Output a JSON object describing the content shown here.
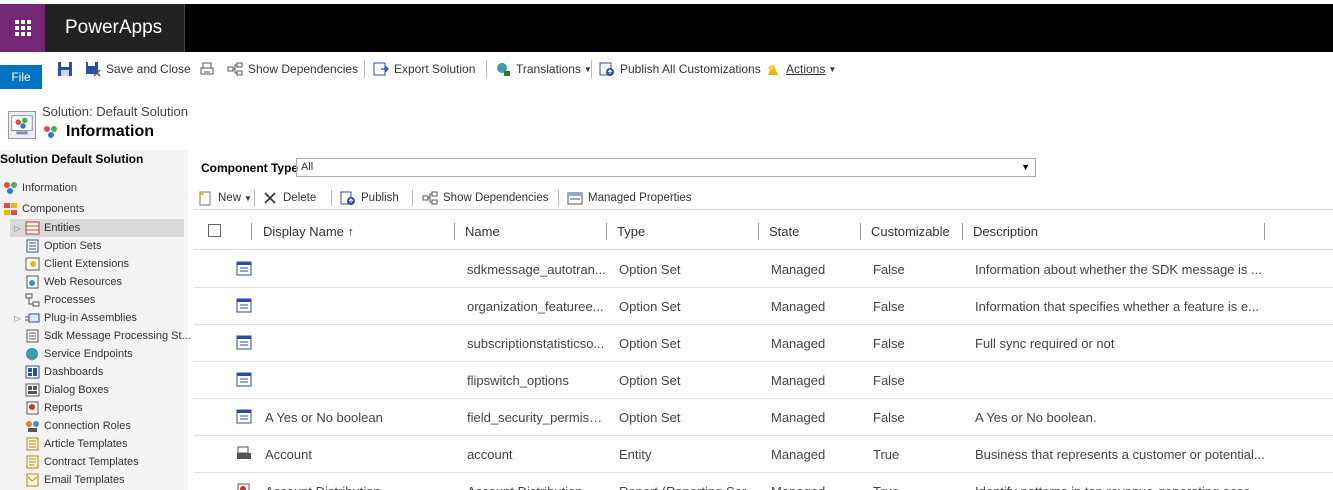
{
  "app": {
    "name": "PowerApps"
  },
  "ribbon": {
    "file": "File",
    "save_close": "Save and Close",
    "show_deps": "Show Dependencies",
    "export": "Export Solution",
    "translations": "Translations",
    "publish_all": "Publish All Customizations",
    "actions": "Actions"
  },
  "header": {
    "solution_line": "Solution: Default Solution",
    "title": "Information"
  },
  "leftnav": {
    "heading": "Solution Default Solution",
    "items": [
      "Information",
      "Components",
      "Entities",
      "Option Sets",
      "Client Extensions",
      "Web Resources",
      "Processes",
      "Plug-in Assemblies",
      "Sdk Message Processing St...",
      "Service Endpoints",
      "Dashboards",
      "Dialog Boxes",
      "Reports",
      "Connection Roles",
      "Article Templates",
      "Contract Templates",
      "Email Templates"
    ]
  },
  "filter": {
    "label": "Component Type",
    "value": "All"
  },
  "toolbar": {
    "new": "New",
    "delete": "Delete",
    "publish": "Publish",
    "show_deps": "Show Dependencies",
    "managed_props": "Managed Properties"
  },
  "grid": {
    "columns": [
      "Display Name ↑",
      "Name",
      "Type",
      "State",
      "Customizable",
      "Description"
    ],
    "rows": [
      {
        "display": "",
        "name": "sdkmessage_autotran...",
        "type": "Option Set",
        "state": "Managed",
        "customizable": "False",
        "description": "Information about whether the SDK message is ...",
        "icon": "option-set-icon"
      },
      {
        "display": "",
        "name": "organization_featuree...",
        "type": "Option Set",
        "state": "Managed",
        "customizable": "False",
        "description": "Information that specifies whether a feature is e...",
        "icon": "option-set-icon"
      },
      {
        "display": "",
        "name": "subscriptionstatisticso...",
        "type": "Option Set",
        "state": "Managed",
        "customizable": "False",
        "description": "Full sync required or not",
        "icon": "option-set-icon"
      },
      {
        "display": "",
        "name": "flipswitch_options",
        "type": "Option Set",
        "state": "Managed",
        "customizable": "False",
        "description": "",
        "icon": "option-set-icon"
      },
      {
        "display": "A Yes or No boolean",
        "name": "field_security_permissi...",
        "type": "Option Set",
        "state": "Managed",
        "customizable": "False",
        "description": "A Yes or No boolean.",
        "icon": "option-set-icon"
      },
      {
        "display": "Account",
        "name": "account",
        "type": "Entity",
        "state": "Managed",
        "customizable": "True",
        "description": "Business that represents a customer or potential...",
        "icon": "entity-icon"
      },
      {
        "display": "Account Distribution",
        "name": "Account Distribution",
        "type": "Report (Reporting Ser...",
        "state": "Managed",
        "customizable": "True",
        "description": "Identify patterns in top revenue-generating acco...",
        "icon": "report-icon"
      }
    ]
  },
  "colors": {
    "waffle": "#742774",
    "file_button": "#0072c6",
    "topbar": "#000000"
  }
}
